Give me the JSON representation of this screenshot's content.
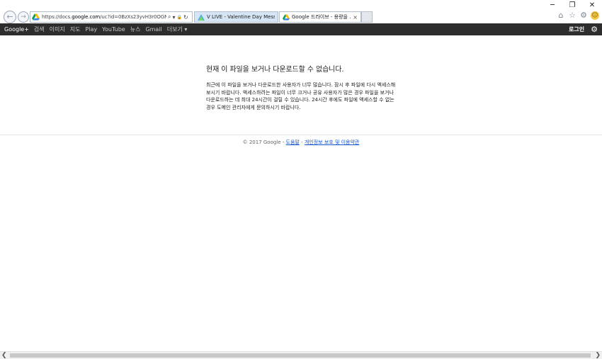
{
  "window": {
    "minimize": "─",
    "restore": "❐",
    "close": "✕"
  },
  "address_bar": {
    "url_prefix": "https://docs.",
    "url_host": "google.com",
    "url_rest": "/uc?id=0BzXs23yvH3r0OGNy",
    "search_glyph": "⌕",
    "dropdown_glyph": "▾",
    "lock_glyph": "🔒",
    "refresh_glyph": "↻"
  },
  "tabs": [
    {
      "title": "V LIVE - Valentine Day Messa...",
      "active": false
    },
    {
      "title": "Google 드라이브 - 용량을 ...",
      "close": "×",
      "active": true
    }
  ],
  "toolbar": {
    "home_glyph": "⌂",
    "favorites_glyph": "☆",
    "tools_glyph": "⚙",
    "feedback_glyph": "☺"
  },
  "gbar": {
    "items": [
      "Google+",
      "검색",
      "이미지",
      "지도",
      "Play",
      "YouTube",
      "뉴스",
      "Gmail",
      "더보기 ▾"
    ],
    "login": "로그인",
    "settings_glyph": "⚙"
  },
  "main": {
    "heading": "현재 이 파일을 보거나 다운로드할 수 없습니다.",
    "message": "최근에 이 파일을 보거나 다운로드한 사용자가 너무 많습니다. 잠시 후 파일에 다시 액세스해 보시기 바랍니다. 액세스하려는 파일이 너무 크거나 공유 사용자가 많은 경우 파일을 보거나 다운로드하는 데 최대 24시간이 걸릴 수 있습니다. 24시간 후에도 파일에 액세스할 수 없는 경우 도메인 관리자에게 문의하시기 바랍니다."
  },
  "footer": {
    "copyright": "© 2017 Google - ",
    "help": "도움말",
    "sep": " - ",
    "privacy": "개인정보 보호 및 이용약관"
  },
  "scrollbar": {
    "left_arrow": "❮",
    "right_arrow": "❯"
  },
  "colors": {
    "gbar_bg": "#2d2d2d",
    "link": "#1155cc",
    "active_tab": "#d6e5f5"
  }
}
